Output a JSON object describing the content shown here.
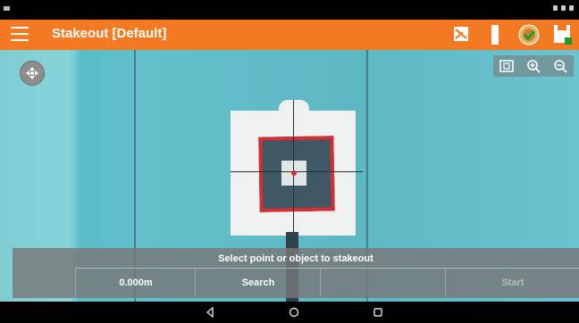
{
  "app": {
    "title": "Stakeout [Default]"
  },
  "colors": {
    "app_bar": "#f37a22",
    "target_red": "#d62d34"
  },
  "map": {
    "controls": [
      "extent-icon",
      "zoom-in-icon",
      "zoom-out-icon"
    ]
  },
  "panel": {
    "message": "Select point or object to stakeout",
    "distance": "0.000m",
    "search_label": "Search",
    "start_label": "Start"
  }
}
